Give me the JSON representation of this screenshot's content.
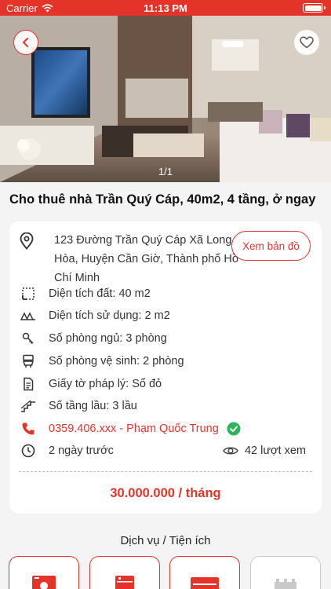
{
  "status_bar": {
    "carrier": "Carrier",
    "time": "11:13 PM"
  },
  "gallery": {
    "counter": "1/1"
  },
  "listing": {
    "title": "Cho thuê nhà Trần Quý Cáp, 40m2, 4 tầng, ở ngay",
    "address": "123 Đường Trần Quý Cáp Xã Long Hòa, Huyện Cần Giờ, Thành phố Hồ Chí Minh",
    "map_button": "Xem bản đồ",
    "land_area": "Diện tích đất: 40 m2",
    "usable_area": "Diện tích sử dụng: 2 m2",
    "bedrooms": "Số phòng ngủ: 3 phòng",
    "bathrooms": "Số phòng vệ sinh: 2 phòng",
    "legal": "Giấy tờ pháp lý: Sổ đỏ",
    "floors": "Số tầng lầu: 3 lầu",
    "contact": "0359.406.xxx - Phạm Quốc Trung",
    "posted": "2 ngày trước",
    "views": "42 lượt xem",
    "price": "30.000.000 / tháng"
  },
  "services": {
    "title": "Dịch vụ / Tiện ích"
  },
  "colors": {
    "accent": "#e4342a",
    "verified": "#2eb35a"
  }
}
